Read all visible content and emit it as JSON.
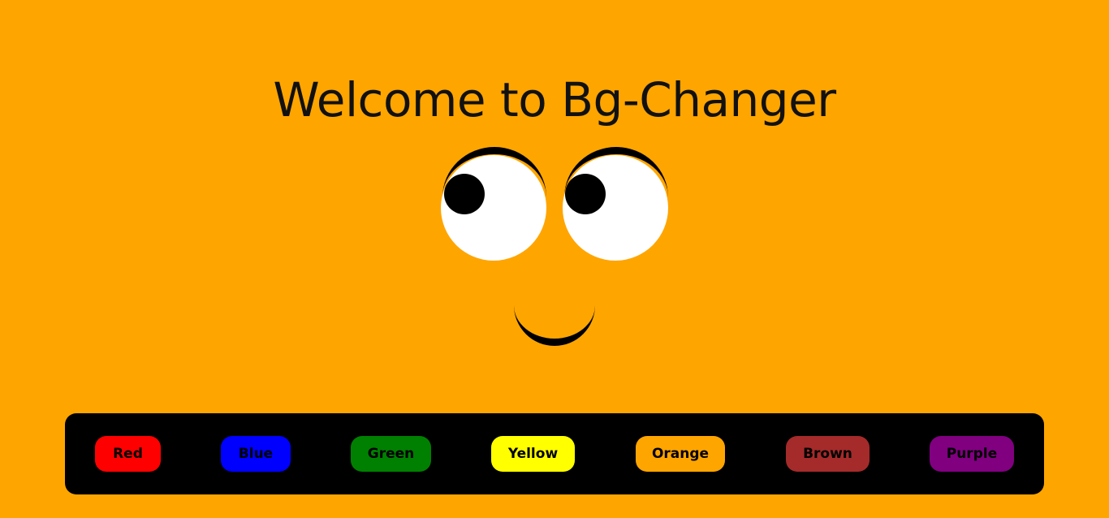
{
  "header": {
    "title": "Welcome to Bg-Changer"
  },
  "page": {
    "background_color": "#ffa500"
  },
  "buttons": [
    {
      "label": "Red",
      "color": "#ff0000"
    },
    {
      "label": "Blue",
      "color": "#0000ff"
    },
    {
      "label": "Green",
      "color": "#008000"
    },
    {
      "label": "Yellow",
      "color": "#ffff00"
    },
    {
      "label": "Orange",
      "color": "#ffa500"
    },
    {
      "label": "Brown",
      "color": "#a52a2a"
    },
    {
      "label": "Purple",
      "color": "#800080"
    }
  ]
}
